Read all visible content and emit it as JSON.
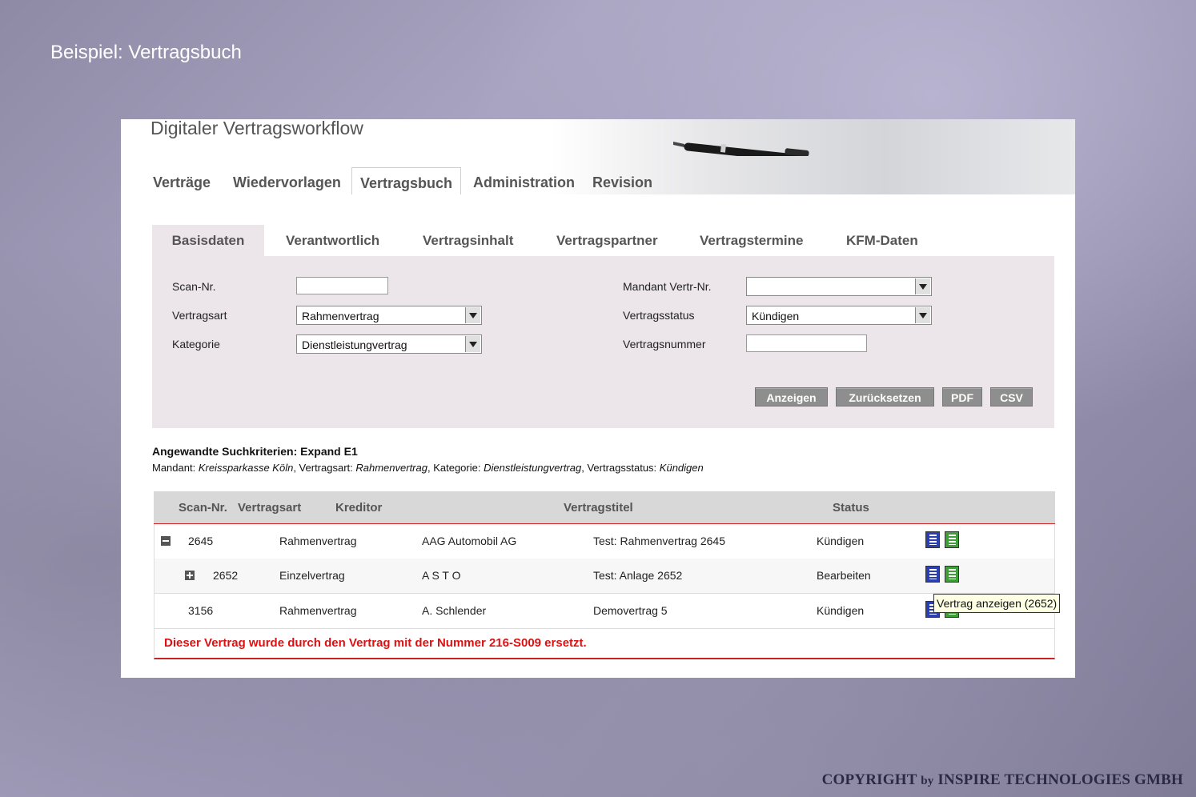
{
  "slide": {
    "title": "Beispiel: Vertragsbuch",
    "copyright_pre": "COPYRIGHT",
    "copyright_by": "by",
    "copyright_post": "INSPIRE TECHNOLOGIES GMBH"
  },
  "app": {
    "title": "Digitaler Vertragsworkflow",
    "main_tabs": [
      "Verträge",
      "Wiedervorlagen",
      "Vertragsbuch",
      "Administration",
      "Revision"
    ],
    "active_main_tab": "Vertragsbuch",
    "sub_tabs": [
      "Basisdaten",
      "Verantwortlich",
      "Vertragsinhalt",
      "Vertragspartner",
      "Vertragstermine",
      "KFM-Daten"
    ],
    "active_sub_tab": "Basisdaten"
  },
  "form": {
    "scan_nr": {
      "label": "Scan-Nr.",
      "value": ""
    },
    "vertragsart": {
      "label": "Vertragsart",
      "value": "Rahmenvertrag"
    },
    "kategorie": {
      "label": "Kategorie",
      "value": "Dienstleistungvertrag"
    },
    "mandant": {
      "label": "Mandant Vertr-Nr.",
      "value": ""
    },
    "vertragsstatus": {
      "label": "Vertragsstatus",
      "value": "Kündigen"
    },
    "vertragsnummer": {
      "label": "Vertragsnummer",
      "value": ""
    },
    "buttons": {
      "show": "Anzeigen",
      "reset": "Zurücksetzen",
      "pdf": "PDF",
      "csv": "CSV"
    }
  },
  "criteria": {
    "title": "Angewandte Suchkriterien: Expand E1",
    "mandant_label": "Mandant:",
    "mandant_value": "Kreissparkasse Köln",
    "vertragsart_label": ", Vertragsart:",
    "vertragsart_value": "Rahmenvertrag",
    "kategorie_label": ", Kategorie:",
    "kategorie_value": "Dienstleistungvertrag",
    "status_label": ", Vertragsstatus:",
    "status_value": "Kündigen"
  },
  "table": {
    "headers": [
      "Scan-Nr.",
      "Vertragsart",
      "Kreditor",
      "Vertragstitel",
      "Status"
    ],
    "rows": [
      {
        "scan": "2645",
        "art": "Rahmenvertrag",
        "kreditor": "AAG Automobil AG",
        "titel": "Test: Rahmenvertrag 2645",
        "status": "Kündigen"
      },
      {
        "scan": "2652",
        "art": "Einzelvertrag",
        "kreditor": "A S T O",
        "titel": "Test: Anlage 2652",
        "status": "Bearbeiten"
      },
      {
        "scan": "3156",
        "art": "Rahmenvertrag",
        "kreditor": "A. Schlender",
        "titel": "Demovertrag 5",
        "status": "Kündigen"
      }
    ],
    "notice": "Dieser Vertrag wurde durch den Vertrag mit der Nummer 216-S009 ersetzt.",
    "tooltip": "Vertrag anzeigen (2652)"
  },
  "icons": {
    "view": "document-view-icon",
    "edit": "document-edit-icon",
    "collapse": "minus-icon",
    "expand": "plus-icon"
  }
}
